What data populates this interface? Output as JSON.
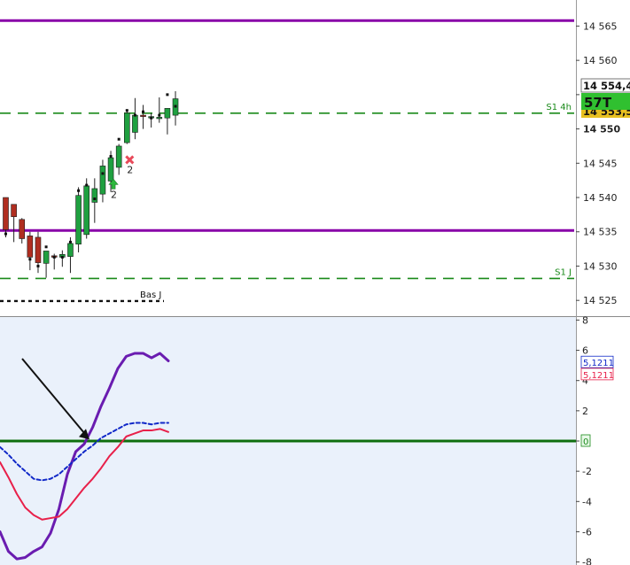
{
  "chart_data": [
    {
      "type": "candlestick",
      "panel": "price",
      "y_ticks": [
        {
          "value": 14525,
          "label": "14 525"
        },
        {
          "value": 14530,
          "label": "14 530"
        },
        {
          "value": 14535,
          "label": "14 535"
        },
        {
          "value": 14540,
          "label": "14 540"
        },
        {
          "value": 14545,
          "label": "14 545"
        },
        {
          "value": 14550,
          "label": "14 550"
        },
        {
          "value": 14555,
          "label": ""
        },
        {
          "value": 14560,
          "label": "14 560"
        },
        {
          "value": 14565,
          "label": "14 565"
        }
      ],
      "ylim": [
        14522.7,
        14568.8
      ],
      "bars": [
        {
          "o": 14540.0,
          "h": 14540.0,
          "l": 14534.2,
          "c": 14535.3,
          "dir": "down",
          "dot": 14534.7
        },
        {
          "o": 14539.0,
          "h": 14539.0,
          "l": 14533.5,
          "c": 14537.2,
          "dir": "down",
          "dot": null
        },
        {
          "o": 14536.8,
          "h": 14537.0,
          "l": 14533.3,
          "c": 14534.0,
          "dir": "down",
          "dot": null
        },
        {
          "o": 14534.4,
          "h": 14535.0,
          "l": 14529.4,
          "c": 14531.3,
          "dir": "down",
          "dot": 14531.0
        },
        {
          "o": 14534.2,
          "h": 14535.0,
          "l": 14529.0,
          "c": 14530.5,
          "dir": "down",
          "dot": 14530.0
        },
        {
          "o": 14530.4,
          "h": 14532.2,
          "l": 14528.3,
          "c": 14532.2,
          "dir": "up",
          "dot": 14532.8
        },
        {
          "o": 14531.3,
          "h": 14531.8,
          "l": 14529.5,
          "c": 14531.5,
          "dir": "down",
          "dot": 14531.3
        },
        {
          "o": 14531.3,
          "h": 14532.3,
          "l": 14529.9,
          "c": 14531.7,
          "dir": "up",
          "dot": 14531.3
        },
        {
          "o": 14531.4,
          "h": 14534.2,
          "l": 14529.0,
          "c": 14533.3,
          "dir": "up",
          "dot": 14533.5
        },
        {
          "o": 14533.2,
          "h": 14541.5,
          "l": 14532.0,
          "c": 14540.3,
          "dir": "up",
          "dot": 14541.0
        },
        {
          "o": 14534.6,
          "h": 14542.8,
          "l": 14534.0,
          "c": 14541.7,
          "dir": "up",
          "dot": 14541.8
        },
        {
          "o": 14539.3,
          "h": 14542.8,
          "l": 14536.3,
          "c": 14541.3,
          "dir": "up",
          "dot": 14539.8
        },
        {
          "o": 14540.5,
          "h": 14545.5,
          "l": 14539.3,
          "c": 14544.6,
          "dir": "up",
          "dot": 14543.5
        },
        {
          "o": 14542.4,
          "h": 14546.8,
          "l": 14540.8,
          "c": 14545.8,
          "dir": "up",
          "dot": 14546.0
        },
        {
          "o": 14544.4,
          "h": 14547.8,
          "l": 14543.3,
          "c": 14547.5,
          "dir": "up",
          "dot": 14548.5
        },
        {
          "o": 14548.0,
          "h": 14552.8,
          "l": 14547.8,
          "c": 14552.3,
          "dir": "up",
          "dot": 14552.7
        },
        {
          "o": 14549.5,
          "h": 14554.5,
          "l": 14548.5,
          "c": 14552.0,
          "dir": "up",
          "dot": 14552.0
        },
        {
          "o": 14552.0,
          "h": 14553.5,
          "l": 14550.0,
          "c": 14552.0,
          "dir": "down",
          "dot": 14552.5
        },
        {
          "o": 14551.8,
          "h": 14552.3,
          "l": 14550.2,
          "c": 14551.8,
          "dir": "up",
          "dot": 14551.6
        },
        {
          "o": 14551.7,
          "h": 14554.6,
          "l": 14550.9,
          "c": 14551.5,
          "dir": "up",
          "dot": 14552.0
        },
        {
          "o": 14551.6,
          "h": 14553.0,
          "l": 14549.2,
          "c": 14553.0,
          "dir": "up",
          "dot": 14555.0
        },
        {
          "o": 14552.0,
          "h": 14555.5,
          "l": 14550.5,
          "c": 14554.4,
          "dir": "up",
          "dot": 14553.3
        }
      ],
      "levels": [
        {
          "value": 14565.8,
          "style": "solid",
          "color": "#8800a8",
          "label": ""
        },
        {
          "value": 14552.3,
          "style": "dashed",
          "color": "#1a8a1a",
          "label": "S1 4h"
        },
        {
          "value": 14535.2,
          "style": "solid",
          "color": "#8800a8",
          "label": ""
        },
        {
          "value": 14528.2,
          "style": "dashed",
          "color": "#1a8a1a",
          "label": "S1 J"
        },
        {
          "value": 14524.9,
          "style": "dotted",
          "color": "#111111",
          "label": "Bas J"
        }
      ],
      "markers": [
        {
          "type": "up-arrow",
          "bar": 13,
          "value": 14541.9,
          "label": "2"
        },
        {
          "type": "x-mark",
          "bar": 15,
          "value": 14545.5,
          "label": "2"
        }
      ],
      "price_tags": [
        {
          "value": 14554.44,
          "text": "14 554,44",
          "bg": "#ffffff",
          "fg": "#111111"
        },
        {
          "text": "57T",
          "bg": "#30c030",
          "fg": "#111111"
        },
        {
          "value": 14553.5,
          "text": "14 553,50",
          "bg": "#e8c020",
          "fg": "#111111"
        }
      ]
    },
    {
      "type": "line",
      "panel": "oscillator",
      "y_ticks": [
        -8,
        -6,
        -4,
        -2,
        0,
        2,
        4,
        6,
        8
      ],
      "ylim": [
        -8.2,
        8.2
      ],
      "series": [
        {
          "color": "#6a1cb0",
          "style": "solid",
          "values": [
            -6.0,
            -7.3,
            -7.8,
            -7.7,
            -7.3,
            -7.0,
            -6.1,
            -4.5,
            -2.2,
            -0.7,
            -0.2,
            0.9,
            2.3,
            3.5,
            4.8,
            5.6,
            5.8,
            5.8,
            5.5,
            5.8,
            5.3
          ]
        },
        {
          "color": "#1028c8",
          "style": "dashed",
          "values": [
            -0.4,
            -0.9,
            -1.5,
            -2.0,
            -2.5,
            -2.6,
            -2.5,
            -2.2,
            -1.7,
            -1.2,
            -0.7,
            -0.3,
            0.2,
            0.5,
            0.8,
            1.1,
            1.2,
            1.2,
            1.1,
            1.2,
            1.2
          ]
        },
        {
          "color": "#e8204a",
          "style": "solid",
          "values": [
            -1.4,
            -2.4,
            -3.5,
            -4.4,
            -4.9,
            -5.2,
            -5.1,
            -5.0,
            -4.5,
            -3.8,
            -3.1,
            -2.5,
            -1.8,
            -1.0,
            -0.4,
            0.3,
            0.5,
            0.7,
            0.7,
            0.8,
            0.6
          ]
        }
      ],
      "zero_line": {
        "value": 0,
        "color": "#0e6e0e"
      },
      "value_tags": [
        {
          "text": "5,1211",
          "color": "#1028c8",
          "value": 5.2
        },
        {
          "text": "5,1211",
          "color": "#e8204a",
          "value": 4.4
        },
        {
          "text": "0",
          "color": "#1a8a1a",
          "value": 0
        }
      ],
      "annotation": {
        "type": "arrow",
        "target_value": 0.1,
        "color": "#111111"
      }
    }
  ]
}
